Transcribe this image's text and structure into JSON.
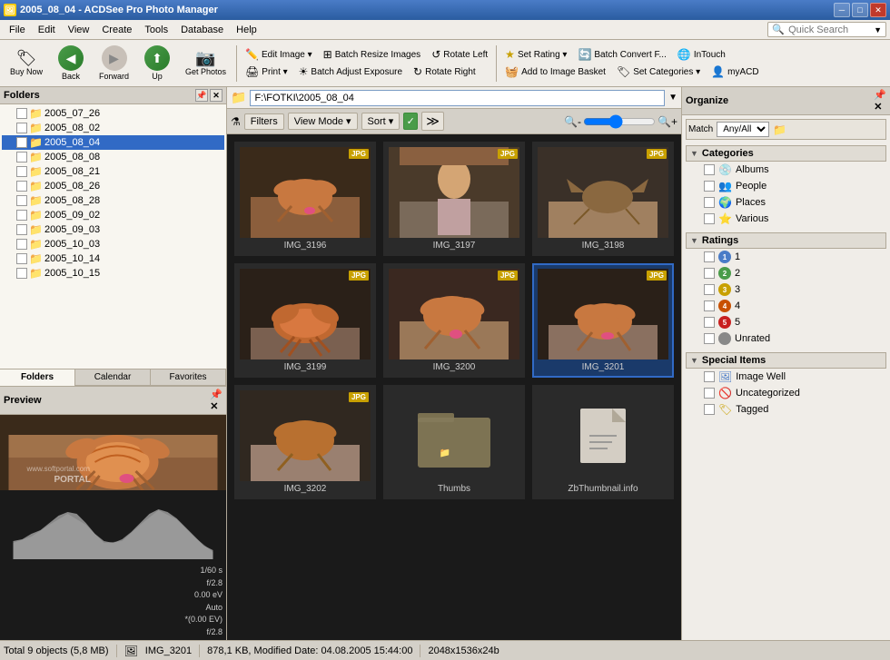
{
  "titleBar": {
    "title": "2005_08_04 - ACDSee Pro Photo Manager",
    "icon": "🖼",
    "controls": {
      "minimize": "─",
      "maximize": "□",
      "close": "✕"
    }
  },
  "menuBar": {
    "items": [
      "File",
      "Edit",
      "View",
      "Create",
      "Tools",
      "Database",
      "Help"
    ],
    "quickSearch": {
      "label": "Quick Search",
      "placeholder": "Quick Search"
    }
  },
  "toolbar": {
    "buttons": [
      {
        "id": "buy-now",
        "icon": "🏷",
        "label": "Buy Now"
      },
      {
        "id": "back",
        "icon": "◀",
        "label": "Back"
      },
      {
        "id": "forward",
        "icon": "▶",
        "label": "Forward"
      },
      {
        "id": "up",
        "icon": "⬆",
        "label": "Up"
      },
      {
        "id": "get-photos",
        "icon": "📷",
        "label": "Get Photos"
      }
    ],
    "editGroup": {
      "editImage": "Edit Image ▾",
      "print": "Print ▾",
      "batchResize": "Batch Resize Images",
      "batchAdjust": "Batch Adjust Exposure",
      "rotateLeft": "Rotate Left",
      "rotateRight": "Rotate Right",
      "setRating": "Set Rating ▾",
      "addToBasket": "Add to Image Basket",
      "batchConvert": "Batch Convert F...",
      "setCategories": "Set Categories ▾",
      "inTouch": "InTouch",
      "myACD": "myACD"
    }
  },
  "pathBar": {
    "path": "F:\\FOTKI\\2005_08_04"
  },
  "contentToolbar": {
    "filters": "Filters",
    "viewMode": "View Mode ▾",
    "sort": "Sort ▾"
  },
  "foldersPanel": {
    "title": "Folders",
    "folders": [
      {
        "name": "2005_07_26",
        "indent": 1,
        "selected": false
      },
      {
        "name": "2005_08_02",
        "indent": 1,
        "selected": false
      },
      {
        "name": "2005_08_04",
        "indent": 1,
        "selected": true
      },
      {
        "name": "2005_08_08",
        "indent": 1,
        "selected": false
      },
      {
        "name": "2005_08_21",
        "indent": 1,
        "selected": false
      },
      {
        "name": "2005_08_26",
        "indent": 1,
        "selected": false
      },
      {
        "name": "2005_08_28",
        "indent": 1,
        "selected": false
      },
      {
        "name": "2005_09_02",
        "indent": 1,
        "selected": false
      },
      {
        "name": "2005_09_03",
        "indent": 1,
        "selected": false
      },
      {
        "name": "2005_10_03",
        "indent": 1,
        "selected": false
      },
      {
        "name": "2005_10_14",
        "indent": 1,
        "selected": false
      },
      {
        "name": "2005_10_15",
        "indent": 1,
        "selected": false
      }
    ],
    "tabs": [
      "Folders",
      "Calendar",
      "Favorites"
    ]
  },
  "previewPanel": {
    "title": "Preview",
    "info": {
      "shutter": "1/60 s",
      "aperture": "f/2.8",
      "ev": "0.00 eV",
      "mode": "Auto",
      "evAdj": "*(0.00 EV)",
      "f": "f/2.8"
    }
  },
  "thumbnails": [
    {
      "id": "img3196",
      "label": "IMG_3196",
      "hasBadge": true,
      "badge": "JPG",
      "type": "crab",
      "selected": false
    },
    {
      "id": "img3197",
      "label": "IMG_3197",
      "hasBadge": true,
      "badge": "JPG",
      "type": "person",
      "selected": false
    },
    {
      "id": "img3198",
      "label": "IMG_3198",
      "hasBadge": true,
      "badge": "JPG",
      "type": "crab2",
      "selected": false
    },
    {
      "id": "img3199",
      "label": "IMG_3199",
      "hasBadge": true,
      "badge": "JPG",
      "type": "lobster",
      "selected": false
    },
    {
      "id": "img3200",
      "label": "IMG_3200",
      "hasBadge": true,
      "badge": "JPG",
      "type": "crab3",
      "selected": false
    },
    {
      "id": "img3201",
      "label": "IMG_3201",
      "hasBadge": true,
      "badge": "JPG",
      "type": "crab4",
      "selected": true
    },
    {
      "id": "img3202",
      "label": "IMG_3202",
      "hasBadge": true,
      "badge": "JPG",
      "type": "crab5",
      "selected": false
    },
    {
      "id": "thumbs",
      "label": "Thumbs",
      "hasBadge": false,
      "type": "folder",
      "selected": false
    },
    {
      "id": "zbthumbnail",
      "label": "ZbThumbnail.info",
      "hasBadge": false,
      "type": "file",
      "selected": false
    }
  ],
  "organizePanel": {
    "title": "Organize",
    "matchLabel": "Match Any/All",
    "matchOptions": [
      "Any",
      "All"
    ],
    "sections": {
      "categories": {
        "label": "Categories",
        "items": [
          {
            "icon": "💿",
            "label": "Albums",
            "color": "#4a7cc7"
          },
          {
            "icon": "👤",
            "label": "People",
            "color": "#4a9c4a"
          },
          {
            "icon": "🌍",
            "label": "Places",
            "color": "#4a9c4a"
          },
          {
            "icon": "⭐",
            "label": "Various",
            "color": "#c8a000"
          }
        ]
      },
      "ratings": {
        "label": "Ratings",
        "items": [
          {
            "dot": "1",
            "dotColor": "#4a7cc7",
            "label": "1"
          },
          {
            "dot": "2",
            "dotColor": "#4a9c4a",
            "label": "2"
          },
          {
            "dot": "3",
            "dotColor": "#c8a000",
            "label": "3"
          },
          {
            "dot": "4",
            "dotColor": "#c85000",
            "label": "4"
          },
          {
            "dot": "5",
            "dotColor": "#c82020",
            "label": "5"
          },
          {
            "dot": "○",
            "dotColor": "#888",
            "label": "Unrated"
          }
        ]
      },
      "specialItems": {
        "label": "Special Items",
        "items": [
          {
            "icon": "🖼",
            "label": "Image Well",
            "color": "#4a7cc7"
          },
          {
            "icon": "🚫",
            "label": "Uncategorized",
            "color": "#c82020"
          },
          {
            "icon": "🏷",
            "label": "Tagged",
            "color": "#c8a000"
          }
        ]
      }
    }
  },
  "statusBar": {
    "totalObjects": "Total 9 objects (5,8 MB)",
    "selectedFile": "IMG_3201",
    "fileInfo": "878,1 KB, Modified Date: 04.08.2005 15:44:00",
    "dimensions": "2048x1536x24b"
  },
  "watermark": "www.softportal.com • PORTAL"
}
